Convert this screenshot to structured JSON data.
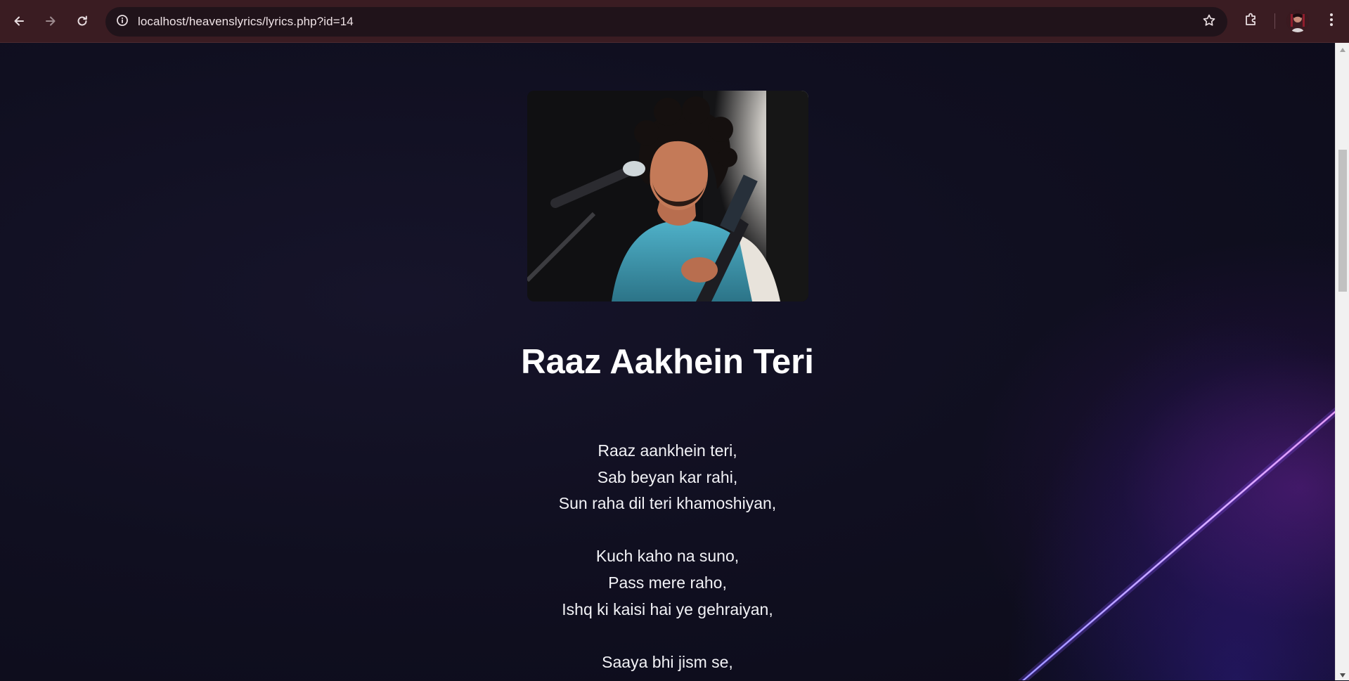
{
  "browser": {
    "url": "localhost/heavenslyrics/lyrics.php?id=14",
    "icons": {
      "back": "arrow-left-icon",
      "forward": "arrow-right-icon",
      "reload": "reload-icon",
      "site_info": "info-icon",
      "bookmark": "star-icon",
      "extensions": "puzzle-icon",
      "profile": "avatar",
      "menu": "kebab-menu-icon"
    }
  },
  "page": {
    "song_image_alt": "singer performing with microphone and guitar",
    "song_title": "Raaz Aakhein Teri",
    "lyrics": [
      {
        "type": "line",
        "text": "Raaz aankhein teri,"
      },
      {
        "type": "line",
        "text": "Sab beyan kar rahi,"
      },
      {
        "type": "line",
        "text": "Sun raha dil teri khamoshiyan,"
      },
      {
        "type": "gap"
      },
      {
        "type": "line",
        "text": "Kuch kaho na suno,"
      },
      {
        "type": "line",
        "text": "Pass mere raho,"
      },
      {
        "type": "line",
        "text": "Ishq ki kaisi hai ye gehraiyan,"
      },
      {
        "type": "gap"
      },
      {
        "type": "line",
        "text": "Saaya bhi jism se,"
      }
    ]
  },
  "colors": {
    "chrome_bg": "#3a1c22",
    "omnibox_bg": "#20131a",
    "page_bg": "#0f0e1d",
    "title_text": "#ffffff",
    "lyrics_text": "#f2f2f6",
    "beam_color": "#b87cff"
  }
}
